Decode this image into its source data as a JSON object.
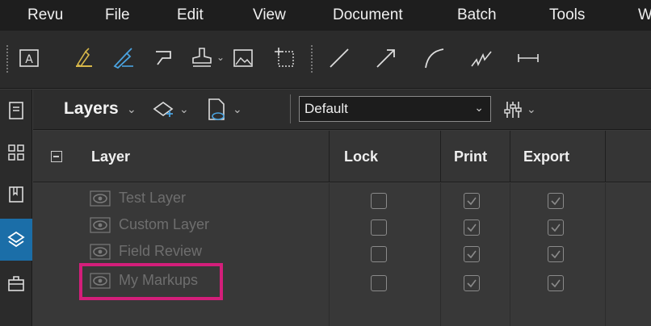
{
  "menu": [
    "Revu",
    "File",
    "Edit",
    "View",
    "Document",
    "Batch",
    "Tools",
    "W"
  ],
  "toolbar": {
    "tools": [
      "text-box-icon",
      "highlight-icon",
      "pen-icon",
      "callout-icon",
      "stamp-icon",
      "image-icon",
      "snapshot-icon",
      "line-icon",
      "arrow-icon",
      "arc-icon",
      "cloud-line-icon",
      "dimension-icon"
    ]
  },
  "rail": [
    "thumbnails-icon",
    "bookmarks-tile-icon",
    "bookmarks-icon",
    "layers-icon",
    "toolchest-icon"
  ],
  "panel": {
    "title": "Layers",
    "preset": "Default"
  },
  "table": {
    "headers": {
      "layer": "Layer",
      "lock": "Lock",
      "print": "Print",
      "export": "Export"
    },
    "rows": [
      {
        "name": "Test Layer",
        "lock": false,
        "print": true,
        "export": true
      },
      {
        "name": "Custom Layer",
        "lock": false,
        "print": true,
        "export": true
      },
      {
        "name": "Field Review",
        "lock": false,
        "print": true,
        "export": true
      },
      {
        "name": "My Markups",
        "lock": false,
        "print": true,
        "export": true
      }
    ]
  },
  "colors": {
    "accent": "#1b6ea8",
    "highlight": "#d31e7a"
  }
}
